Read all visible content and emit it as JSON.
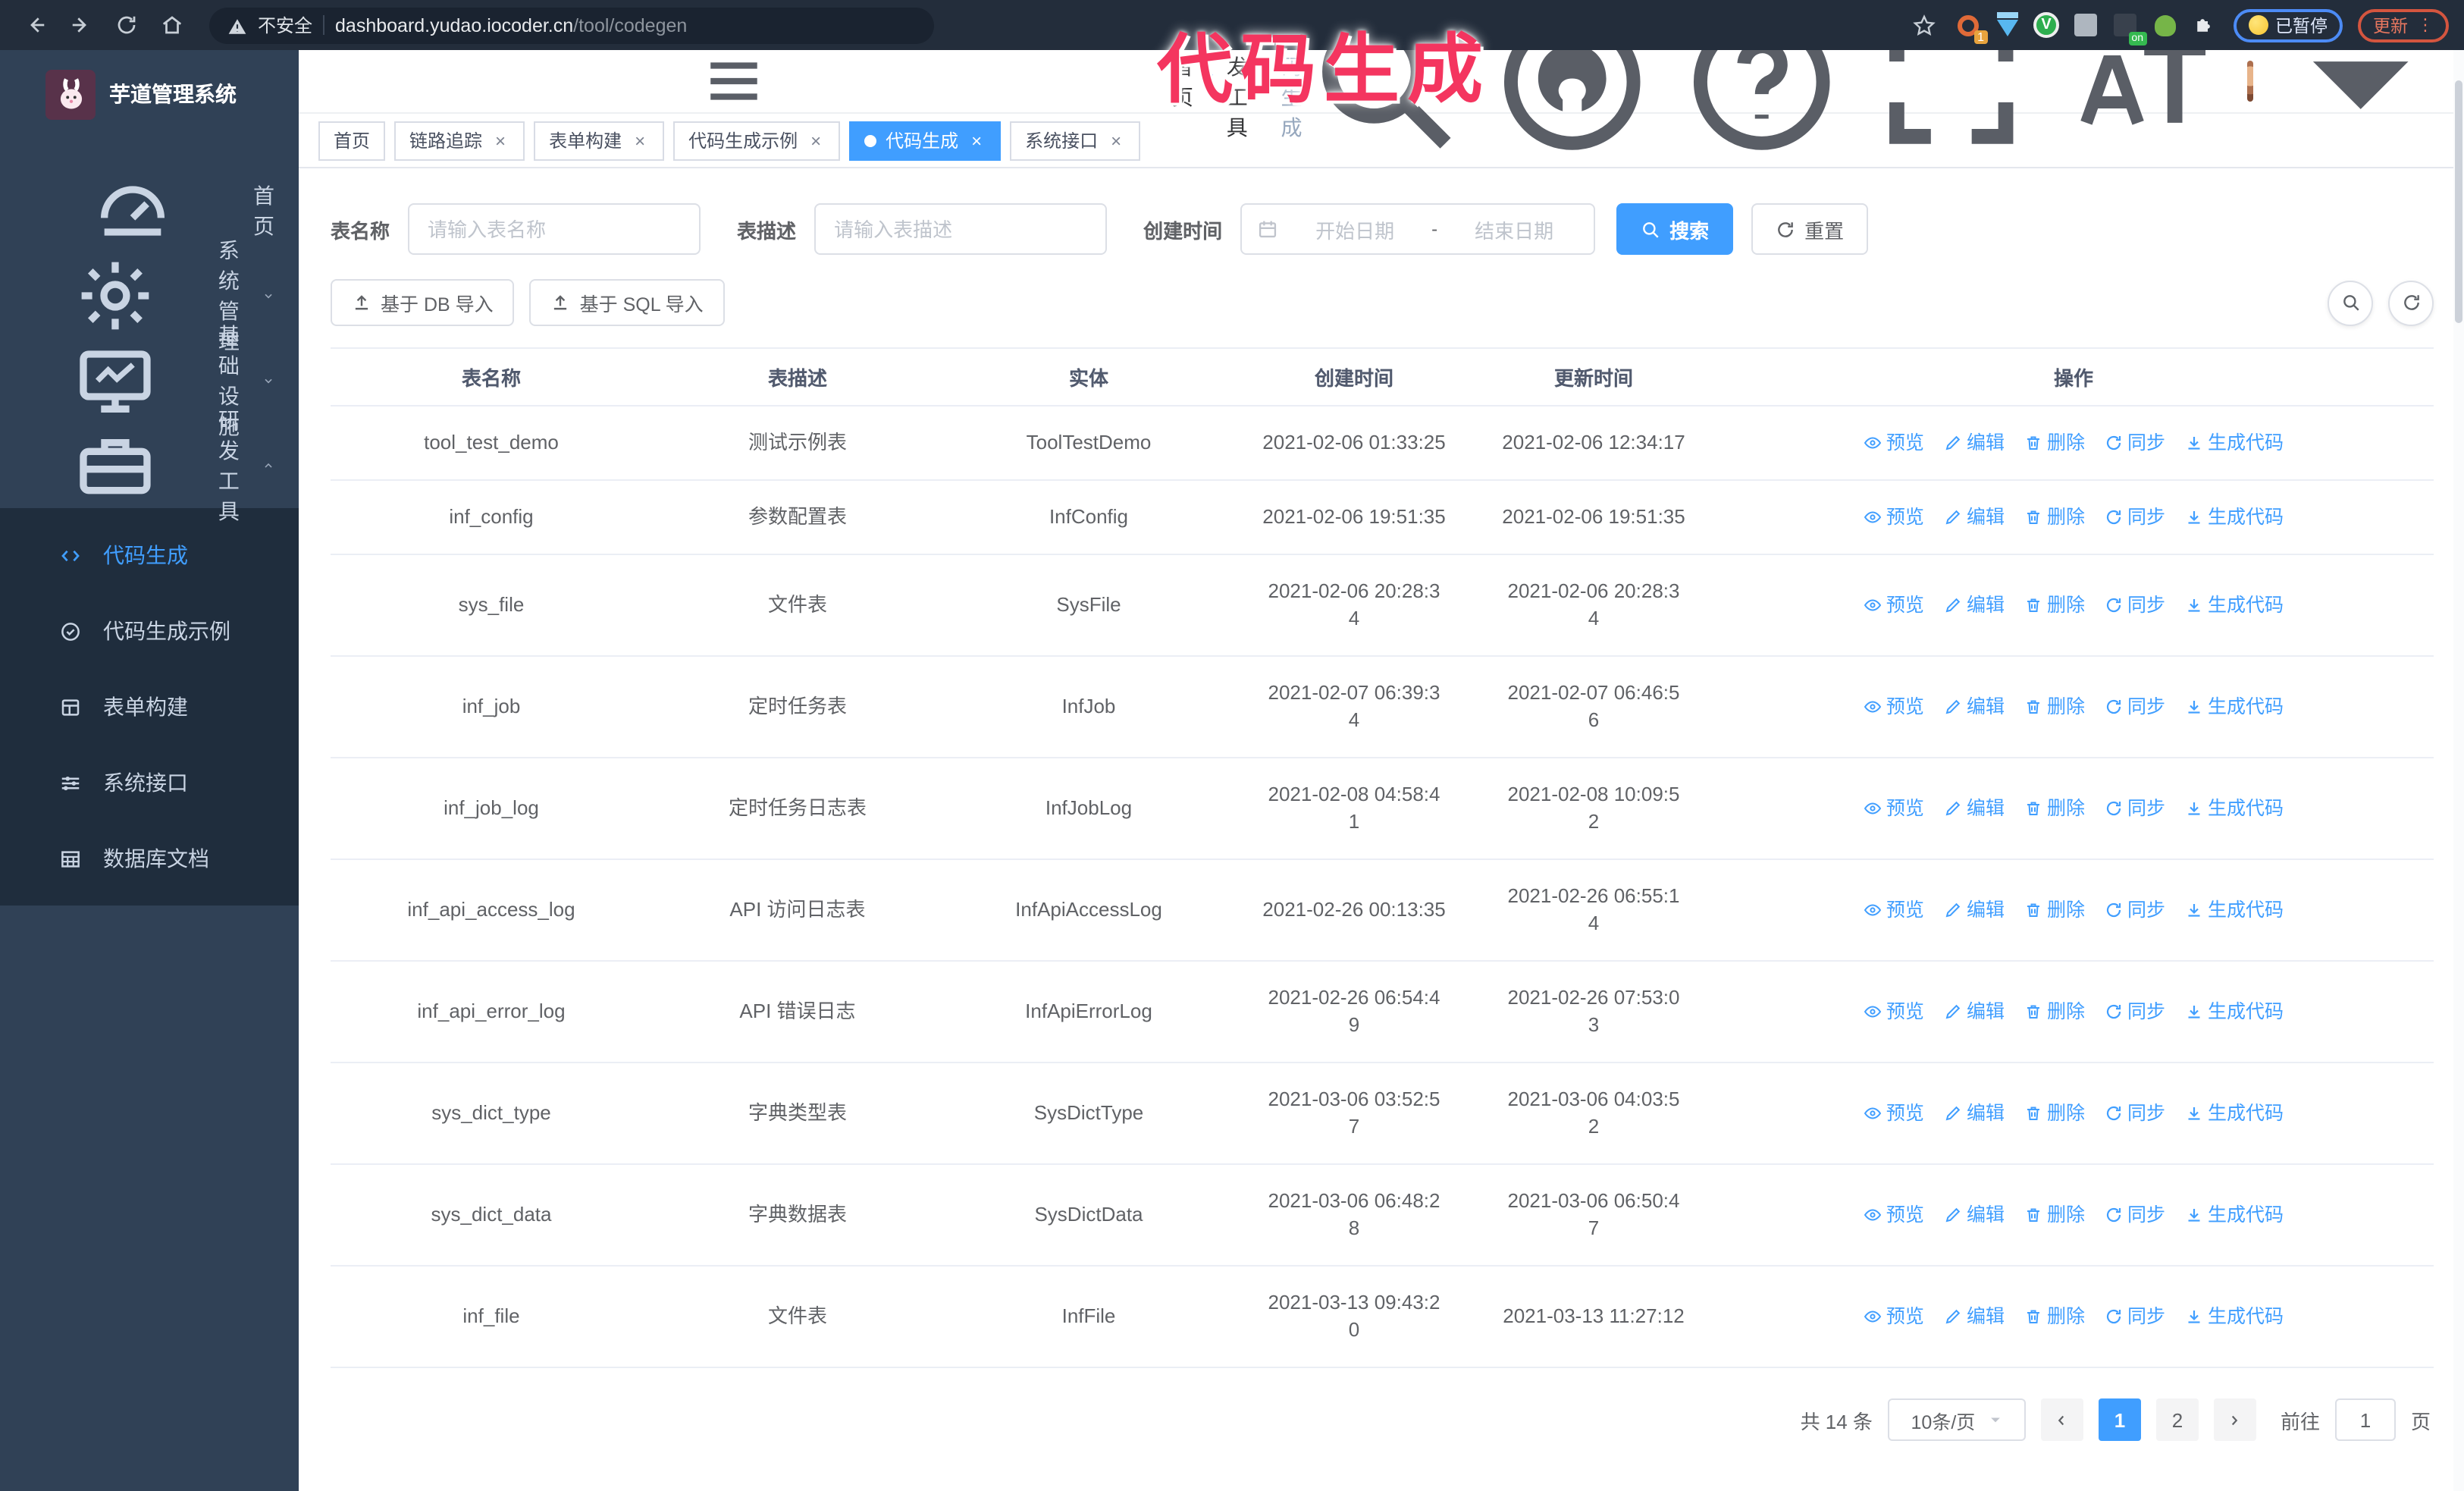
{
  "browser": {
    "security_label": "不安全",
    "url_host": "dashboard.yudao.iocoder.cn",
    "url_path": "/tool/codegen",
    "ext_badge": "1",
    "ext_on_badge": "on",
    "ext_v_label": "V",
    "paused_badge": "已暂停",
    "update_button": "更新",
    "update_dots": "⋮"
  },
  "annotation": {
    "text": "代码生成"
  },
  "sidebar": {
    "title": "芋道管理系统",
    "items": [
      {
        "label": "首页"
      },
      {
        "label": "系统管理"
      },
      {
        "label": "基础设施"
      },
      {
        "label": "研发工具"
      }
    ],
    "subitems": [
      {
        "label": "代码生成"
      },
      {
        "label": "代码生成示例"
      },
      {
        "label": "表单构建"
      },
      {
        "label": "系统接口"
      },
      {
        "label": "数据库文档"
      }
    ]
  },
  "header": {
    "breadcrumb": [
      "首页",
      "研发工具",
      "代码生成"
    ],
    "separator": "/"
  },
  "tabs": [
    {
      "label": "首页"
    },
    {
      "label": "链路追踪"
    },
    {
      "label": "表单构建"
    },
    {
      "label": "代码生成示例"
    },
    {
      "label": "代码生成"
    },
    {
      "label": "系统接口"
    }
  ],
  "tab_close": "×",
  "filters": {
    "table_name_label": "表名称",
    "table_name_placeholder": "请输入表名称",
    "table_desc_label": "表描述",
    "table_desc_placeholder": "请输入表描述",
    "create_time_label": "创建时间",
    "date_start_placeholder": "开始日期",
    "date_separator": "-",
    "date_end_placeholder": "结束日期",
    "search_button": "搜索",
    "reset_button": "重置"
  },
  "toolbar": {
    "import_db": "基于 DB 导入",
    "import_sql": "基于 SQL 导入"
  },
  "table": {
    "columns": [
      "表名称",
      "表描述",
      "实体",
      "创建时间",
      "更新时间",
      "操作"
    ],
    "actions": [
      "预览",
      "编辑",
      "删除",
      "同步",
      "生成代码"
    ],
    "rows": [
      {
        "name": "tool_test_demo",
        "desc": "测试示例表",
        "entity": "ToolTestDemo",
        "created": "2021-02-06 01:33:25",
        "updated": "2021-02-06 12:34:17"
      },
      {
        "name": "inf_config",
        "desc": "参数配置表",
        "entity": "InfConfig",
        "created": "2021-02-06 19:51:35",
        "updated": "2021-02-06 19:51:35"
      },
      {
        "name": "sys_file",
        "desc": "文件表",
        "entity": "SysFile",
        "created": "2021-02-06 20:28:3\n4",
        "updated": "2021-02-06 20:28:3\n4"
      },
      {
        "name": "inf_job",
        "desc": "定时任务表",
        "entity": "InfJob",
        "created": "2021-02-07 06:39:3\n4",
        "updated": "2021-02-07 06:46:5\n6"
      },
      {
        "name": "inf_job_log",
        "desc": "定时任务日志表",
        "entity": "InfJobLog",
        "created": "2021-02-08 04:58:4\n1",
        "updated": "2021-02-08 10:09:5\n2"
      },
      {
        "name": "inf_api_access_log",
        "desc": "API 访问日志表",
        "entity": "InfApiAccessLog",
        "created": "2021-02-26 00:13:35",
        "updated": "2021-02-26 06:55:1\n4"
      },
      {
        "name": "inf_api_error_log",
        "desc": "API 错误日志",
        "entity": "InfApiErrorLog",
        "created": "2021-02-26 06:54:4\n9",
        "updated": "2021-02-26 07:53:0\n3"
      },
      {
        "name": "sys_dict_type",
        "desc": "字典类型表",
        "entity": "SysDictType",
        "created": "2021-03-06 03:52:5\n7",
        "updated": "2021-03-06 04:03:5\n2"
      },
      {
        "name": "sys_dict_data",
        "desc": "字典数据表",
        "entity": "SysDictData",
        "created": "2021-03-06 06:48:2\n8",
        "updated": "2021-03-06 06:50:4\n7"
      },
      {
        "name": "inf_file",
        "desc": "文件表",
        "entity": "InfFile",
        "created": "2021-03-13 09:43:2\n0",
        "updated": "2021-03-13 11:27:12"
      }
    ]
  },
  "pagination": {
    "total": "共 14 条",
    "page_size": "10条/页",
    "pages": [
      "1",
      "2"
    ],
    "goto_label": "前往",
    "goto_value": "1",
    "goto_suffix": "页"
  },
  "colors": {
    "accent": "#409eff",
    "annotation": "#f4355f",
    "sidebar_bg": "#304156",
    "submenu_bg": "#1f2d3d"
  }
}
